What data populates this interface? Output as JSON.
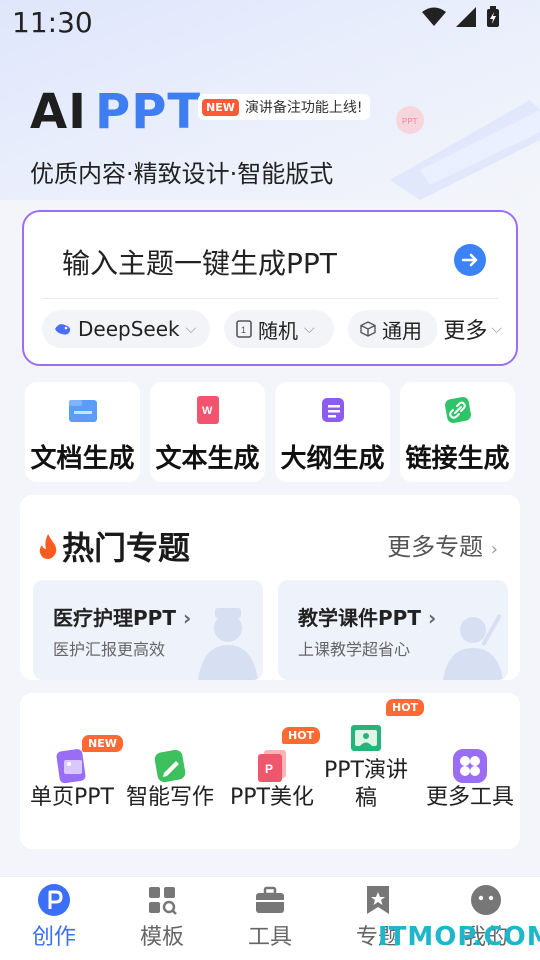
{
  "status": {
    "time": "11:30"
  },
  "hero": {
    "brand_ai": "AI",
    "brand_ppt": "PPT",
    "new_tag": "NEW",
    "notice": "演讲备注功能上线!",
    "tagline": "优质内容·精致设计·智能版式"
  },
  "input": {
    "placeholder": "输入主题一键生成PPT"
  },
  "chips": [
    {
      "label": "DeepSeek"
    },
    {
      "label": "随机"
    },
    {
      "label": "通用"
    }
  ],
  "more_label": "更多",
  "tools": [
    {
      "label": "文档生成"
    },
    {
      "label": "文本生成"
    },
    {
      "label": "大纲生成"
    },
    {
      "label": "链接生成"
    }
  ],
  "hot": {
    "title": "热门专题",
    "more": "更多专题",
    "topics": [
      {
        "title": "医疗护理PPT",
        "subtitle": "医护汇报更高效"
      },
      {
        "title": "教学课件PPT",
        "subtitle": "上课教学超省心"
      }
    ]
  },
  "more_tools": [
    {
      "label": "单页PPT",
      "badge": "NEW"
    },
    {
      "label": "智能写作",
      "badge": ""
    },
    {
      "label": "PPT美化",
      "badge": "HOT"
    },
    {
      "label": "PPT演讲稿",
      "badge": "HOT"
    },
    {
      "label": "更多工具",
      "badge": ""
    }
  ],
  "nav": [
    {
      "label": "创作",
      "active": true
    },
    {
      "label": "模板",
      "active": false
    },
    {
      "label": "工具",
      "active": false
    },
    {
      "label": "专题",
      "active": false
    },
    {
      "label": "我的",
      "active": false
    }
  ],
  "watermark": "ITMOP.COM",
  "colors": {
    "accent": "#3b82f6",
    "border": "#9c6ff0",
    "hot": "#ff6a33"
  }
}
